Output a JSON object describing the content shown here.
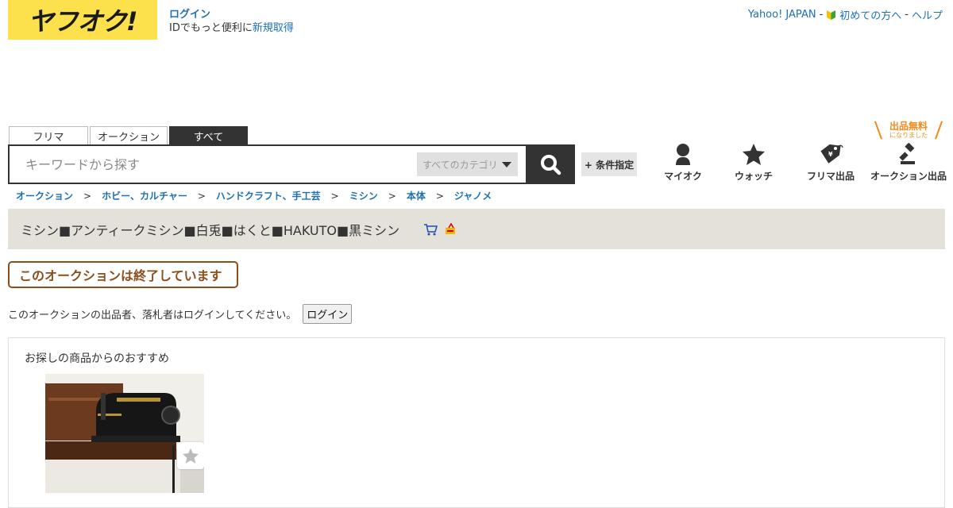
{
  "header": {
    "logo_text": "ヤフオク!",
    "login_link": "ログイン",
    "login_sub_prefix": "IDでもっと便利に",
    "login_sub_link": "新規取得",
    "top_links": {
      "yahoo": "Yahoo! JAPAN",
      "sep1": "-",
      "beginner": "初めての方へ",
      "sep2": "-",
      "help": "ヘルプ"
    }
  },
  "search": {
    "tabs": [
      "フリマ",
      "オークション",
      "すべて"
    ],
    "active_tab": "すべて",
    "placeholder": "キーワードから探す",
    "category_select": "すべてのカテゴリ",
    "condition_button": "+ 条件指定"
  },
  "nav": {
    "myauc": "マイオク",
    "watch": "ウォッチ",
    "flea_listing": "フリマ出品",
    "auction_listing": "オークション出品",
    "free_badge_main": "出品無料",
    "free_badge_sub": "になりました"
  },
  "breadcrumb": [
    "オークション",
    "ホビー、カルチャー",
    "ハンドクラフト、手工芸",
    "ミシン",
    "本体",
    "ジャノメ"
  ],
  "breadcrumb_sep": ">",
  "item": {
    "title": "ミシン■アンティークミシン■白兎■はくと■HAKUTO■黒ミシン",
    "ended_label": "このオークションは終了しています",
    "login_notice": "このオークションの出品者、落札者はログインしてください。",
    "login_button": "ログイン"
  },
  "recommend": {
    "title": "お探しの商品からのおすすめ"
  },
  "colors": {
    "logo_bg": "#fce14d",
    "link": "#1e6fb5",
    "ended_border": "#8b4f1c",
    "title_bg": "#e3e1da",
    "badge_orange": "#f08c1b"
  }
}
